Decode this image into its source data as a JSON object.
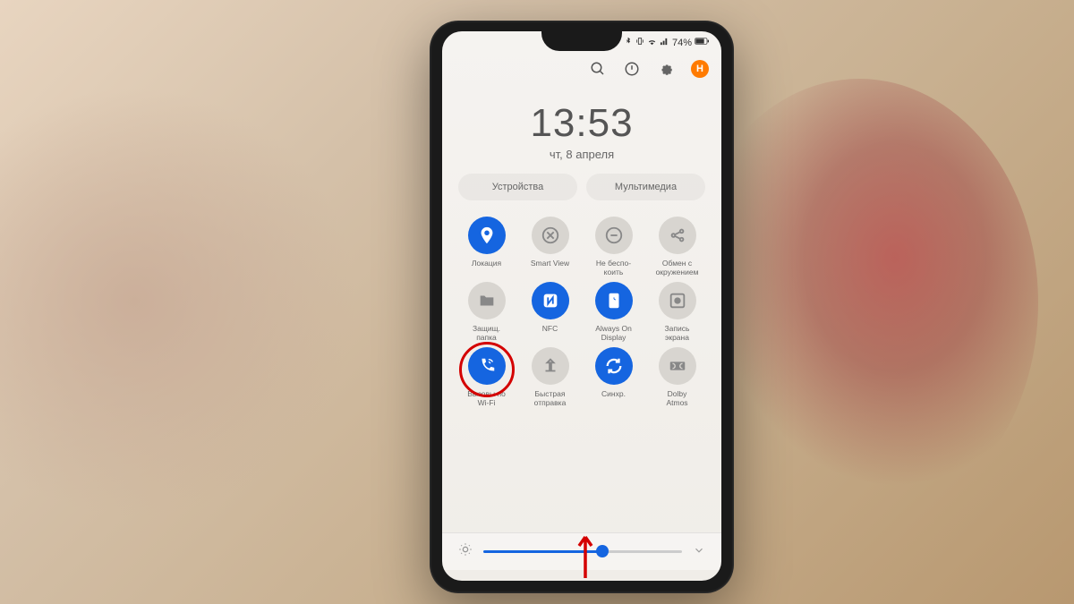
{
  "status": {
    "battery": "74%",
    "notif_badge": "H"
  },
  "clock": {
    "time": "13:53",
    "date": "чт, 8 апреля"
  },
  "tabs": {
    "devices": "Устройства",
    "media": "Мультимедиа"
  },
  "toggles": [
    {
      "label": "Локация",
      "active": true,
      "icon": "location"
    },
    {
      "label": "Smart View",
      "active": false,
      "icon": "smartview"
    },
    {
      "label": "Не беспо-\nкоить",
      "active": false,
      "icon": "dnd"
    },
    {
      "label": "Обмен с\nокружением",
      "active": false,
      "icon": "share"
    },
    {
      "label": "Защищ.\nпапка",
      "active": false,
      "icon": "folder"
    },
    {
      "label": "NFC",
      "active": true,
      "icon": "nfc"
    },
    {
      "label": "Always On\nDisplay",
      "active": true,
      "icon": "aod"
    },
    {
      "label": "Запись\nэкрана",
      "active": false,
      "icon": "record"
    },
    {
      "label": "Вызовы по\nWi-Fi",
      "active": true,
      "icon": "wificall",
      "highlight": true
    },
    {
      "label": "Быстрая\nотправка",
      "active": false,
      "icon": "quickshare"
    },
    {
      "label": "Синхр.",
      "active": true,
      "icon": "sync"
    },
    {
      "label": "Dolby\nAtmos",
      "active": false,
      "icon": "dolby"
    }
  ],
  "brightness": {
    "value": 60
  },
  "colors": {
    "accent": "#1565e0",
    "highlight": "#d40000"
  }
}
